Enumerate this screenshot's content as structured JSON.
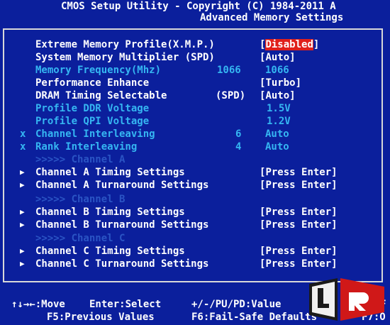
{
  "header": {
    "title": "CMOS Setup Utility - Copyright (C) 1984-2011 A",
    "subtitle": "Advanced Memory Settings"
  },
  "settings": [
    {
      "label": "Extreme Memory Profile(X.M.P.)",
      "mid": "",
      "value": "Disabled",
      "value_brackets": true,
      "selected": true,
      "style": "white",
      "mark": ""
    },
    {
      "label": "System Memory Multiplier (SPD)",
      "mid": "",
      "value": "Auto",
      "value_brackets": true,
      "style": "white",
      "mark": ""
    },
    {
      "label": "Memory Frequency(Mhz)",
      "mid": "1066",
      "value": "1066",
      "value_brackets": false,
      "style": "cyan",
      "mark": ""
    },
    {
      "label": "Performance Enhance",
      "mid": "",
      "value": "Turbo",
      "value_brackets": true,
      "style": "white",
      "mark": ""
    },
    {
      "label": "DRAM Timing Selectable",
      "mid": "(SPD)",
      "value": "Auto",
      "value_brackets": true,
      "style": "white",
      "mark": ""
    },
    {
      "label": "Profile DDR Voltage",
      "mid": "",
      "value": "1.5V",
      "value_brackets": false,
      "style": "cyan",
      "mark": ""
    },
    {
      "label": "Profile QPI Voltage",
      "mid": "",
      "value": "1.2V",
      "value_brackets": false,
      "style": "cyan",
      "mark": ""
    },
    {
      "label": "Channel Interleaving",
      "mid": "6",
      "value": "Auto",
      "value_brackets": false,
      "style": "cyan",
      "mark": "x"
    },
    {
      "label": "Rank Interleaving",
      "mid": "4",
      "value": "Auto",
      "value_brackets": false,
      "style": "cyan",
      "mark": "x"
    }
  ],
  "channels": [
    {
      "header": ">>>>> Channel A",
      "timing": "Channel A Timing Settings",
      "turnaround": "Channel A Turnaround Settings",
      "action": "Press Enter"
    },
    {
      "header": ">>>>> Channel B",
      "timing": "Channel B Timing Settings",
      "turnaround": "Channel B Turnaround Settings",
      "action": "Press Enter"
    },
    {
      "header": ">>>>> Channel C",
      "timing": "Channel C Timing Settings",
      "turnaround": "Channel C Turnaround Settings",
      "action": "Press Enter"
    }
  ],
  "footer": {
    "move": "↑↓→←:Move",
    "enter": "Enter:Select",
    "value": "+/-/PU/PD:Value",
    "f10": "F",
    "f5": "F5:Previous Values",
    "f6": "F6:Fail-Safe Defaults",
    "f7": "F7:O"
  },
  "colors": {
    "background": "#0b1f9c",
    "cyan_text": "#35b6f2",
    "highlight": "#e0201a",
    "dim_header": "#2a54c4"
  },
  "icons": {
    "submenu": "triangle-right-icon",
    "logo": "legit-reviews-logo"
  }
}
